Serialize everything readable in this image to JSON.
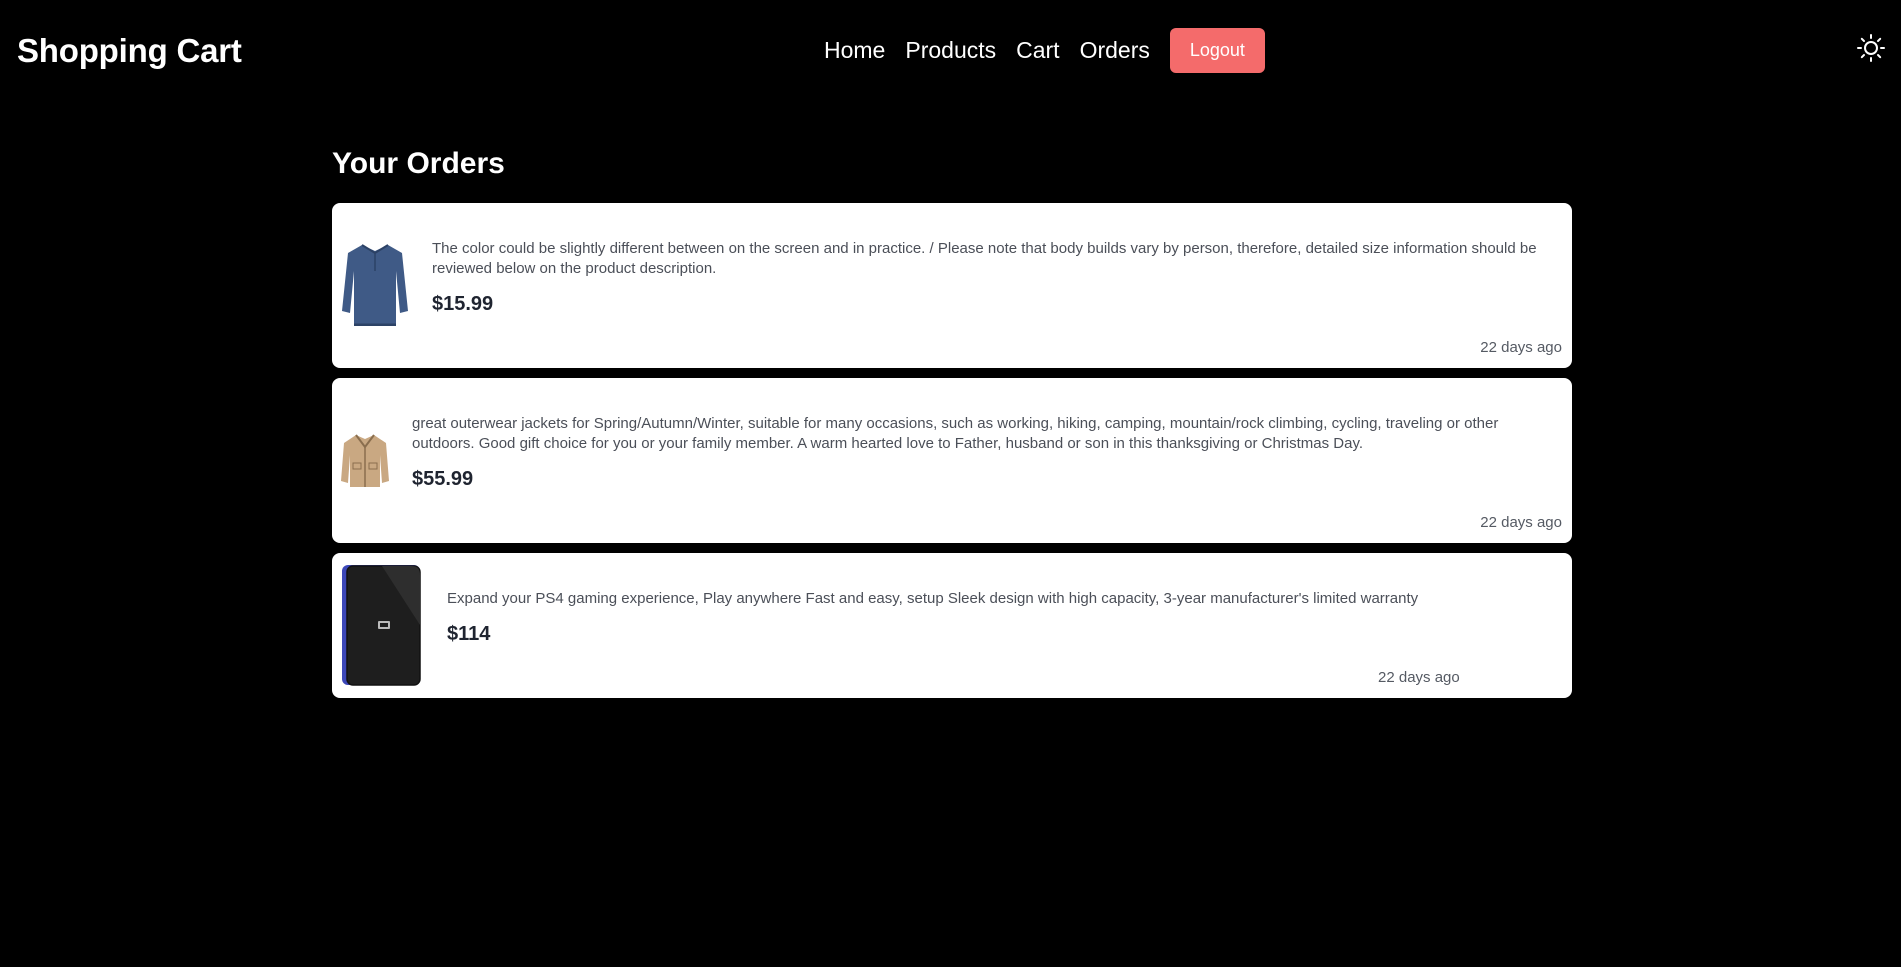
{
  "app": {
    "brand": "Shopping Cart"
  },
  "nav": {
    "items": [
      {
        "label": "Home"
      },
      {
        "label": "Products"
      },
      {
        "label": "Cart"
      },
      {
        "label": "Orders"
      }
    ],
    "logout_label": "Logout",
    "theme_icon": "sun-icon"
  },
  "page": {
    "title": "Your Orders"
  },
  "orders": [
    {
      "image": "shirt-image",
      "description": "The color could be slightly different between on the screen and in practice. / Please note that body builds vary by person, therefore, detailed size information should be reviewed below on the product description.",
      "price": "$15.99",
      "time": "22 days ago"
    },
    {
      "image": "jacket-image",
      "description": "great outerwear jackets for Spring/Autumn/Winter, suitable for many occasions, such as working, hiking, camping, mountain/rock climbing, cycling, traveling or other outdoors. Good gift choice for you or your family member. A warm hearted love to Father, husband or son in this thanksgiving or Christmas Day.",
      "price": "$55.99",
      "time": "22 days ago"
    },
    {
      "image": "hard-drive-image",
      "description": "Expand your PS4 gaming experience, Play anywhere Fast and easy, setup Sleek design with high capacity, 3-year manufacturer's limited warranty",
      "price": "$114",
      "time": "22 days ago"
    }
  ],
  "colors": {
    "background": "#000000",
    "card": "#ffffff",
    "logout": "#f46b6b"
  }
}
